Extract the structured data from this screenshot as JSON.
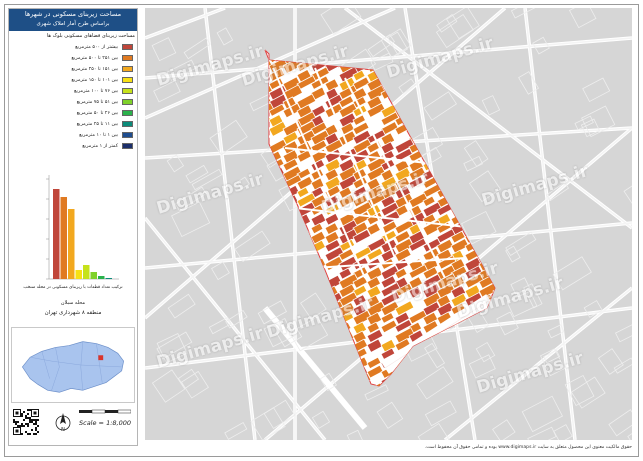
{
  "legend": {
    "title_line1": "مساحت زیربنای مسکونی در شهرها",
    "title_line2": "براساس طرح آمار املاک شهری",
    "subtitle": "مساحت زیربنای فضاهای مسکونی بلوک ها",
    "items": [
      {
        "label": "بیشتر از ۵۰۰ مترمربع",
        "color": "#c0463a"
      },
      {
        "label": "بین ۲۵۱ تا ۵۰۰ مترمربع",
        "color": "#e07a22"
      },
      {
        "label": "بین ۱۵۱ تا ۲۵۰ مترمربع",
        "color": "#f2a81f"
      },
      {
        "label": "بین ۱۰۱ تا ۱۵۰ مترمربع",
        "color": "#f7e014"
      },
      {
        "label": "بین ۷۶ تا ۱۰۰ مترمربع",
        "color": "#c6e21b"
      },
      {
        "label": "بین ۵۱ تا ۷۵ مترمربع",
        "color": "#7fd12a"
      },
      {
        "label": "بین ۲۶ تا ۵۰ مترمربع",
        "color": "#2bb24c"
      },
      {
        "label": "بین ۱۱ تا ۲۵ مترمربع",
        "color": "#0c8b7a"
      },
      {
        "label": "بین ۱ تا ۱۰ مترمربع",
        "color": "#1f4d8f"
      },
      {
        "label": "کمتر از ۱ مترمربع",
        "color": "#1c2f6b"
      }
    ]
  },
  "histogram": {
    "caption": "ترکیب تعداد قطعات با زیربنای مسکونی در محله منتخب",
    "values": [
      0.9,
      0.82,
      0.7,
      0.09,
      0.14,
      0.07,
      0.03,
      0.01
    ]
  },
  "location": {
    "label": "محله سبلان",
    "district": "منطقه ۸ شهرداری تهران"
  },
  "scale": "Scale = 1:8,000",
  "north": "N",
  "watermark": "Digimaps.ir",
  "footer": "حقوق مالکیت معنوی این محصول متعلق به سایت www.digimaps.ir بوده و تمامی حقوق آن محفوظ است."
}
